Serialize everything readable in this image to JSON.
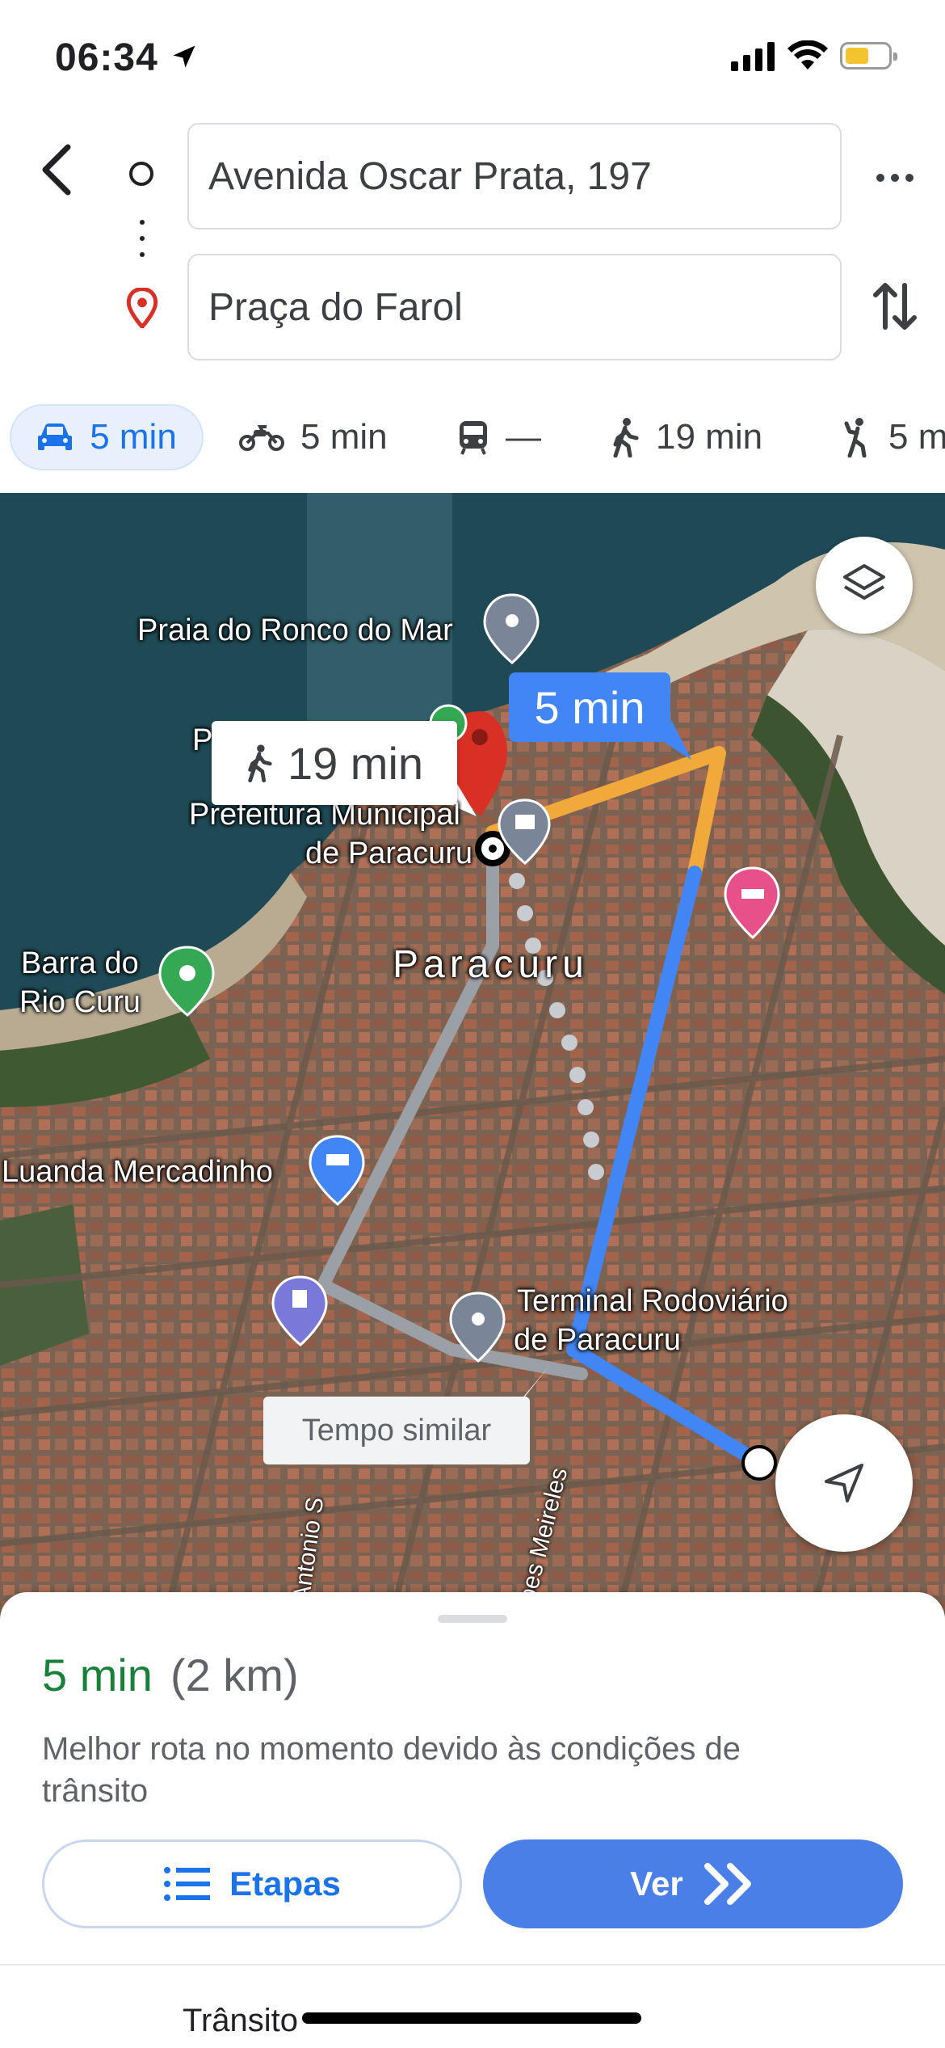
{
  "status_bar": {
    "time": "06:34"
  },
  "directions": {
    "origin": "Avenida Oscar Prata, 197",
    "destination": "Praça do Farol"
  },
  "modes": [
    {
      "name": "car",
      "label": "5 min",
      "active": true
    },
    {
      "name": "motorcycle",
      "label": "5 min"
    },
    {
      "name": "transit",
      "label": "—"
    },
    {
      "name": "walk",
      "label": "19 min"
    },
    {
      "name": "ride",
      "label": "5 m"
    }
  ],
  "map": {
    "labels": {
      "praia": "Praia do Ronco do Mar",
      "prefeitura_1": "Prefeitura Municipal",
      "prefeitura_2": "de Paracuru",
      "p_partial": "P",
      "city": "Paracuru",
      "barra_1": "Barra do",
      "barra_2": "Rio Curu",
      "luanda": "Luanda Mercadinho",
      "terminal_1": "Terminal Rodoviário",
      "terminal_2": "de Paracuru",
      "street_antonio": "Av. Antonio S",
      "street_lopes": "Lopes Meireles"
    },
    "drive_bubble": "5 min",
    "walk_bubble": "19 min",
    "similar_bubble": "Tempo similar",
    "route_color": "#4285f4",
    "traffic_color": "#f2a93b"
  },
  "sheet": {
    "duration": "5 min",
    "distance": "(2 km)",
    "description": "Melhor rota no momento devido às condições de trânsito",
    "steps_label": "Etapas",
    "go_label": "Ver"
  },
  "bottom_bar": {
    "tab_label": "Trânsito"
  }
}
